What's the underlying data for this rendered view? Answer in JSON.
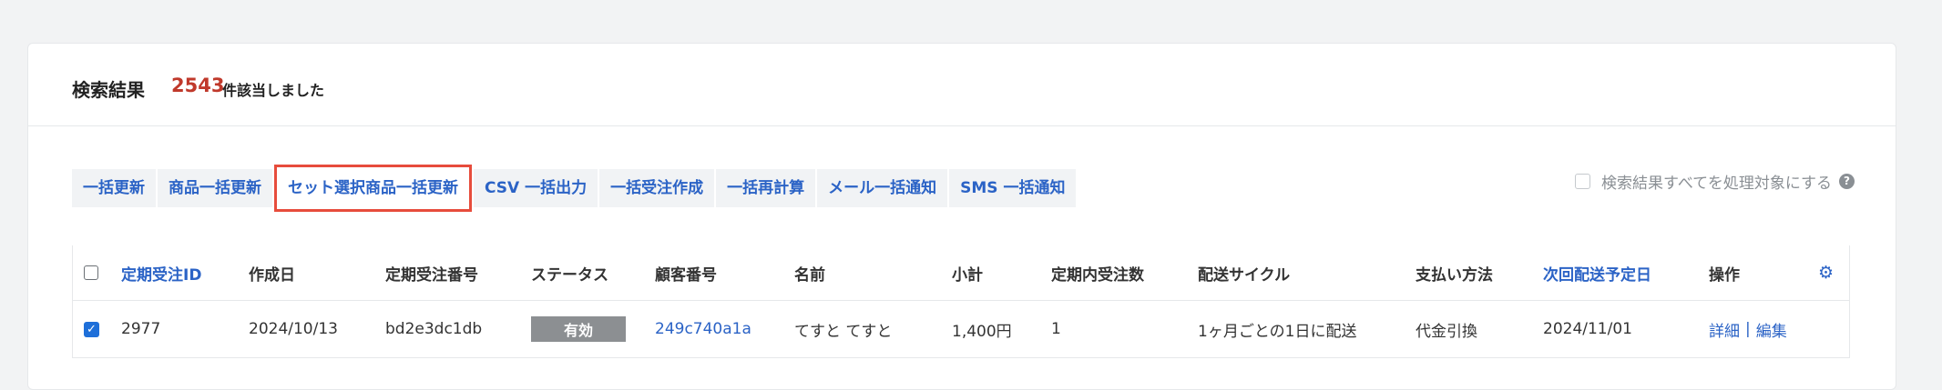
{
  "header": {
    "title": "検索結果",
    "count": "2543",
    "suffix": "件該当しました"
  },
  "toolbar": {
    "buttons": [
      "一括更新",
      "商品一括更新",
      "セット選択商品一括更新",
      "CSV 一括出力",
      "一括受注作成",
      "一括再計算",
      "メール一括通知",
      "SMS 一括通知"
    ],
    "select_all_label": "検索結果すべてを処理対象にする",
    "help_icon": "?"
  },
  "table": {
    "columns": [
      "定期受注ID",
      "作成日",
      "定期受注番号",
      "ステータス",
      "顧客番号",
      "名前",
      "小計",
      "定期内受注数",
      "配送サイクル",
      "支払い方法",
      "次回配送予定日",
      "操作"
    ],
    "settings_icon": "⚙",
    "rows": [
      {
        "checked": "✓",
        "id": "2977",
        "created": "2024/10/13",
        "order_no": "bd2e3dc1db",
        "status": "有効",
        "customer_no": "249c740a1a",
        "name": "てすと てすと",
        "subtotal": "1,400円",
        "count": "1",
        "cycle": "1ヶ月ごとの1日に配送",
        "payment": "代金引換",
        "next_date": "2024/11/01",
        "action_detail": "詳細",
        "action_sep": "|",
        "action_edit": "編集"
      }
    ]
  },
  "colors": {
    "accent": "#2b63c6",
    "count": "#c0392b",
    "highlight_border": "#e74c3c",
    "status_badge": "#8c8f92"
  }
}
